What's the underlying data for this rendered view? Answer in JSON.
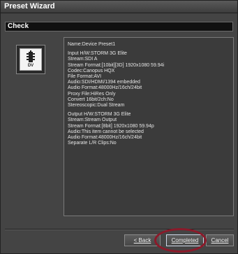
{
  "window": {
    "title": "Preset Wizard"
  },
  "section": {
    "title": "Check"
  },
  "device_icon": {
    "label": "DV",
    "icon": "dv-device-icon"
  },
  "details": [
    "Name:Device Preset1",
    "",
    "Input H/W:STORM 3G Elite",
    "Stream:SDI A",
    "Stream Format:[10bit][3D] 1920x1080 59.94i",
    "Codec:Canopus HQX",
    "File Format:AVI",
    "Audio:SDI/HDMI/1394 embedded",
    "Audio Format:48000Hz/16ch/24bit",
    "Proxy File:HiRes Only",
    "Convert 16bit/2ch:No",
    "Stereoscopic:Dual Stream",
    "",
    "Output H/W:STORM 3G Elite",
    "Stream:Stream Output",
    "Stream Format:[8bit] 1920x1080 59.94p",
    "Audio:This item cannot be selected",
    "Audio Format:48000Hz/16ch/24bit",
    "Separate L/R Clips:No"
  ],
  "buttons": {
    "back": "< Back",
    "completed": "Completed",
    "cancel": "Cancel"
  },
  "colors": {
    "background": "#444444",
    "highlight_ring": "#8b1a2a"
  }
}
